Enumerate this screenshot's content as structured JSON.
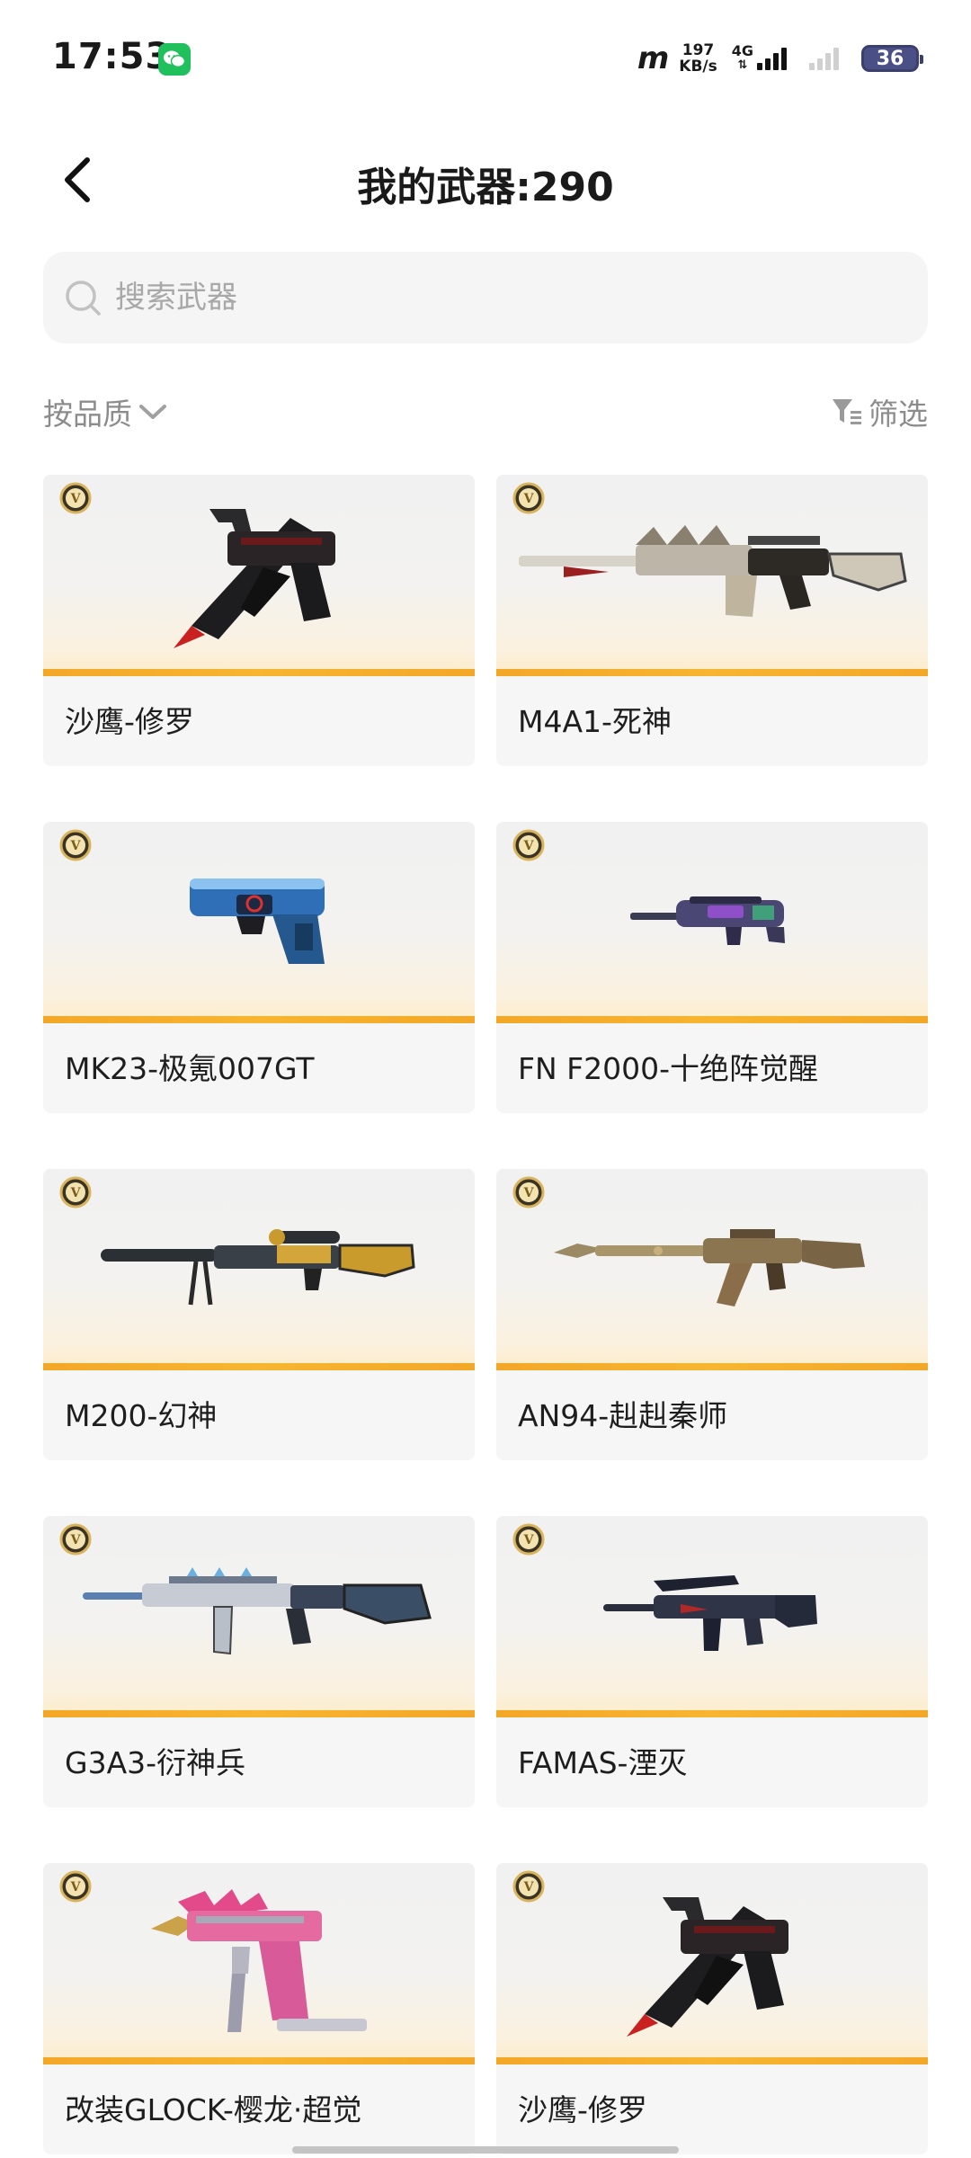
{
  "status_bar": {
    "time": "17:53",
    "carrier_logo": "m",
    "speed_value": "197",
    "speed_unit": "KB/s",
    "network_type": "4G",
    "battery": "36"
  },
  "header": {
    "title": "我的武器:290",
    "back_icon": "chevron-left-icon"
  },
  "search": {
    "placeholder": "搜索武器"
  },
  "filters": {
    "sort_label": "按品质",
    "filter_label": "筛选"
  },
  "weapons": [
    {
      "name": "沙鹰-修罗",
      "badge": "V",
      "icon": "desert-eagle-shura-icon"
    },
    {
      "name": "M4A1-死神",
      "badge": "V",
      "icon": "m4a1-reaper-icon"
    },
    {
      "name": "MK23-极氪007GT",
      "badge": "V",
      "icon": "mk23-zeekr-icon"
    },
    {
      "name": "FN F2000-十绝阵觉醒",
      "badge": "V",
      "icon": "fn-f2000-icon"
    },
    {
      "name": "M200-幻神",
      "badge": "V",
      "icon": "m200-sniper-icon"
    },
    {
      "name": "AN94-赳赳秦师",
      "badge": "V",
      "icon": "an94-rifle-icon"
    },
    {
      "name": "G3A3-衍神兵",
      "badge": "V",
      "icon": "g3a3-rifle-icon"
    },
    {
      "name": "FAMAS-湮灭",
      "badge": "V",
      "icon": "famas-rifle-icon"
    },
    {
      "name": "改装GLOCK-樱龙·超觉",
      "badge": "V",
      "icon": "glock-sakura-dragon-icon"
    },
    {
      "name": "沙鹰-修罗",
      "badge": "V",
      "icon": "desert-eagle-shura-icon"
    }
  ],
  "colors": {
    "accent_stripe": "#f3a728",
    "badge_gold": "#c9a24a",
    "card_bg": "#f6f6f6",
    "battery_fill": "#4a4f85"
  }
}
